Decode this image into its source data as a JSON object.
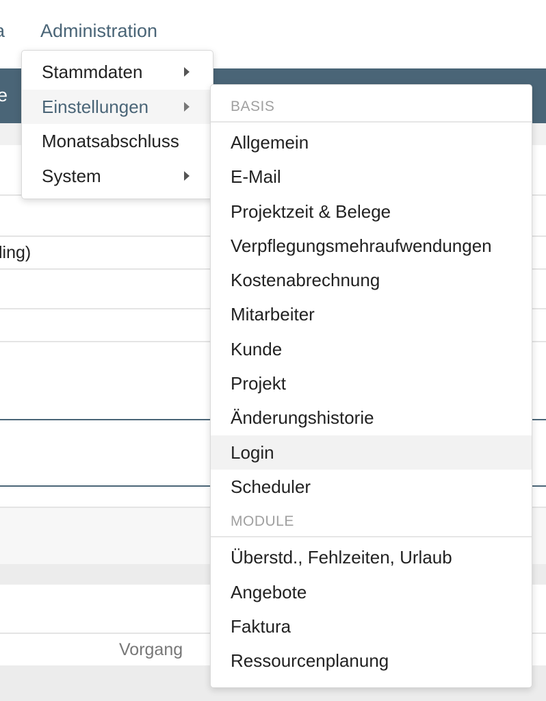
{
  "nav": {
    "clipped_item": "a",
    "administration": "Administration"
  },
  "header": {
    "clipped_text": "e"
  },
  "background": {
    "row1_text": "ling)",
    "row2_text": "Vorgang"
  },
  "admin_menu": {
    "items": [
      {
        "label": "Stammdaten",
        "has_submenu": true
      },
      {
        "label": "Einstellungen",
        "has_submenu": true,
        "active": true
      },
      {
        "label": "Monatsabschluss",
        "has_submenu": false
      },
      {
        "label": "System",
        "has_submenu": true
      }
    ]
  },
  "settings_menu": {
    "sections": [
      {
        "header": "BASIS",
        "items": [
          "Allgemein",
          "E-Mail",
          "Projektzeit & Belege",
          "Verpflegungsmehraufwendungen",
          "Kostenabrechnung",
          "Mitarbeiter",
          "Kunde",
          "Projekt",
          "Änderungshistorie",
          "Login",
          "Scheduler"
        ]
      },
      {
        "header": "MODULE",
        "items": [
          "Überstd., Fehlzeiten, Urlaub",
          "Angebote",
          "Faktura",
          "Ressourcenplanung"
        ]
      }
    ],
    "hovered_item": "Login"
  },
  "colors": {
    "accent": "#4a6577",
    "menu_hover": "#f2f2f2",
    "section_header": "#a0a0a0"
  }
}
